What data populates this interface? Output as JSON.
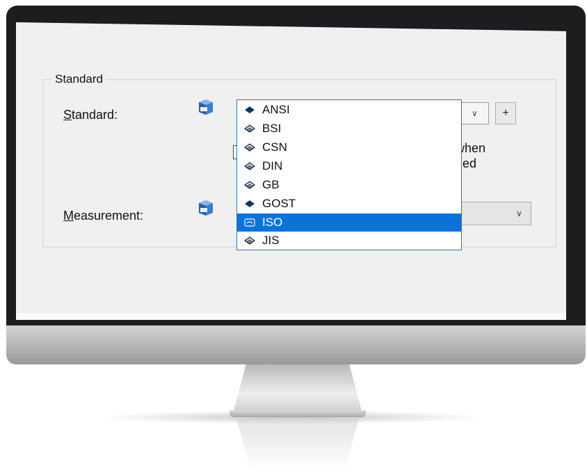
{
  "group": {
    "title": "Standard"
  },
  "standard_row": {
    "label_underlined": "S",
    "label_rest": "tandard:"
  },
  "measurement_row": {
    "label_underlined": "M",
    "label_rest": "easurement:"
  },
  "plus_label": "+",
  "check_text_line1": "when",
  "check_text_line2": "ged",
  "dropdown": {
    "selected": "ISO",
    "items": [
      {
        "label": "ANSI",
        "icon": "book-icon-filled"
      },
      {
        "label": "BSI",
        "icon": "book-icon-outline"
      },
      {
        "label": "CSN",
        "icon": "book-icon-outline"
      },
      {
        "label": "DIN",
        "icon": "book-icon-outline"
      },
      {
        "label": "GB",
        "icon": "book-icon-outline"
      },
      {
        "label": "GOST",
        "icon": "book-icon-filled"
      },
      {
        "label": "ISO",
        "icon": "book-icon-open"
      },
      {
        "label": "JIS",
        "icon": "book-icon-outline"
      }
    ]
  },
  "colors": {
    "selection": "#0a73d9",
    "bezel": "#1d1d1f",
    "window": "#f0f0f0"
  }
}
